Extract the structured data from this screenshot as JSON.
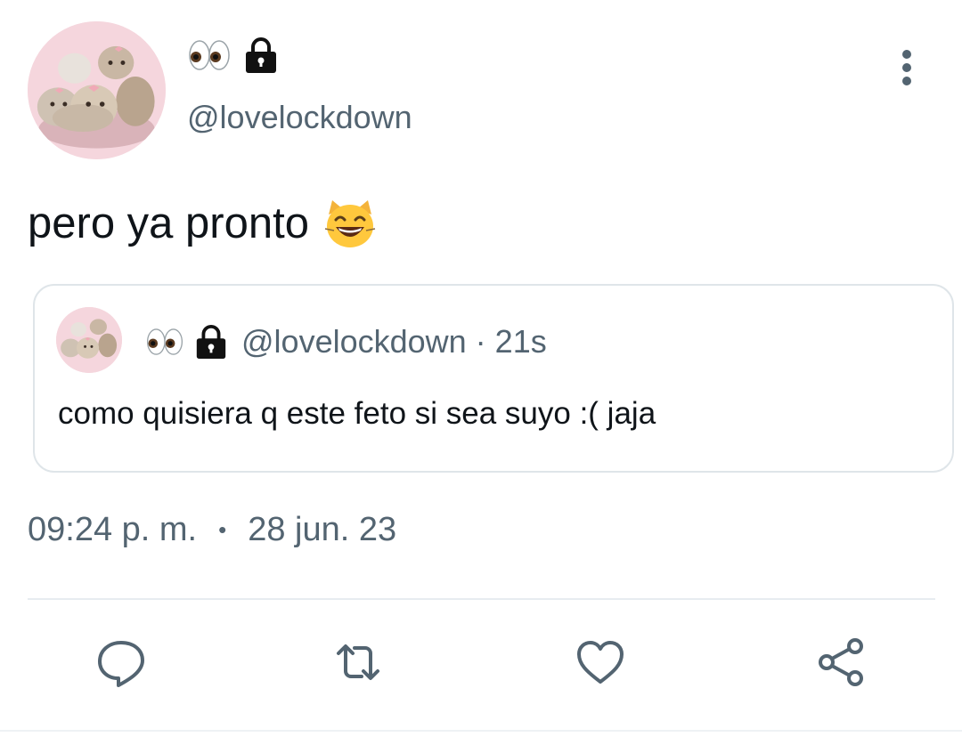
{
  "author": {
    "name_emojis": [
      "👀",
      "🔒"
    ],
    "handle": "@lovelockdown"
  },
  "tweet": {
    "text": "pero ya pronto",
    "emoji": "😸"
  },
  "quoted": {
    "name_emojis": [
      "👀",
      "🔒"
    ],
    "handle": "@lovelockdown",
    "separator": "·",
    "age": "21s",
    "text": "como quisiera q este feto si sea suyo :( jaja"
  },
  "meta": {
    "time": "09:24 p. m.",
    "dot": "•",
    "date": "28 jun. 23"
  },
  "actions": [
    {
      "name": "reply",
      "icon": "reply-icon"
    },
    {
      "name": "retweet",
      "icon": "retweet-icon"
    },
    {
      "name": "like",
      "icon": "heart-icon"
    },
    {
      "name": "share",
      "icon": "share-icon"
    }
  ],
  "colors": {
    "text": "#0f1419",
    "secondary": "#536471",
    "border": "#dfe5e9"
  }
}
